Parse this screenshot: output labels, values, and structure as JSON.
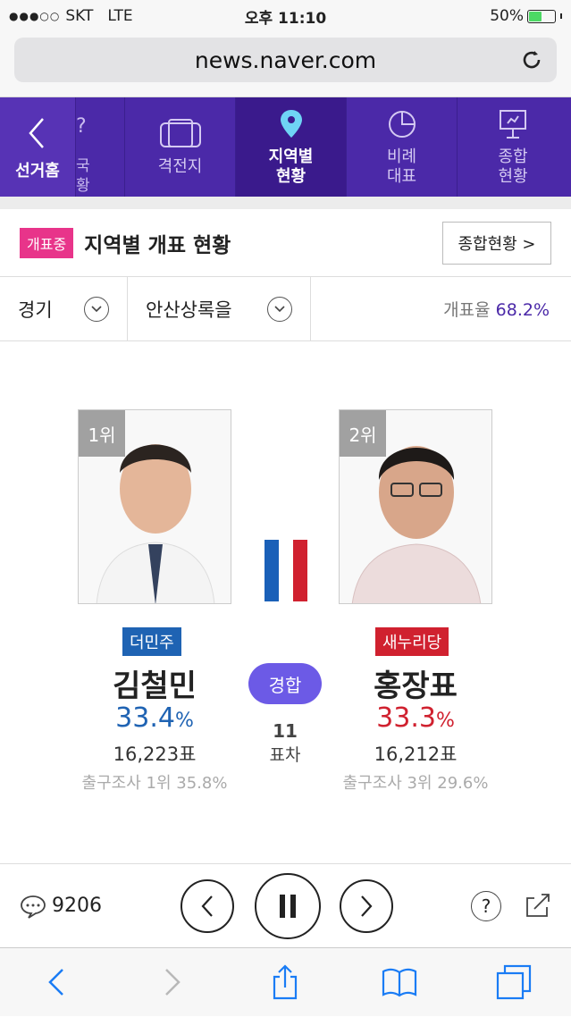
{
  "status_bar": {
    "carrier": "SKT",
    "network": "LTE",
    "time": "오후 11:10",
    "battery": "50%"
  },
  "browser": {
    "url": "news.naver.com"
  },
  "nav": {
    "back_label": "선거홈",
    "cut_item_chars": [
      "국",
      "황"
    ],
    "items": [
      {
        "label_line1": "격전지",
        "label_line2": "",
        "icon": "camera-icon"
      },
      {
        "label_line1": "지역별",
        "label_line2": "현황",
        "icon": "location-pin-icon",
        "active": true
      },
      {
        "label_line1": "비례",
        "label_line2": "대표",
        "icon": "pie-chart-icon"
      },
      {
        "label_line1": "종합",
        "label_line2": "현황",
        "icon": "presentation-icon"
      }
    ]
  },
  "header": {
    "badge": "개표중",
    "title": "지역별 개표 현황",
    "summary_button": "종합현황 >"
  },
  "filters": {
    "region": "경기",
    "district": "안산상록을",
    "count_label": "개표율",
    "count_rate": "68.2%"
  },
  "candidates": [
    {
      "rank": "1위",
      "party": "더민주",
      "party_color": "#1f63b3",
      "name": "김철민",
      "pct": "33.4",
      "pct_unit": "%",
      "pct_color": "#1f63b3",
      "votes": "16,223표",
      "exit_poll": "출구조사 1위 35.8%"
    },
    {
      "rank": "2위",
      "party": "새누리당",
      "party_color": "#d0212f",
      "name": "홍장표",
      "pct": "33.3",
      "pct_unit": "%",
      "pct_color": "#d0212f",
      "votes": "16,212표",
      "exit_poll": "출구조사 3위 29.6%"
    }
  ],
  "race": {
    "status": "경합",
    "diff_value": "11",
    "diff_label": "표차"
  },
  "controls": {
    "comment_count": "9206"
  }
}
